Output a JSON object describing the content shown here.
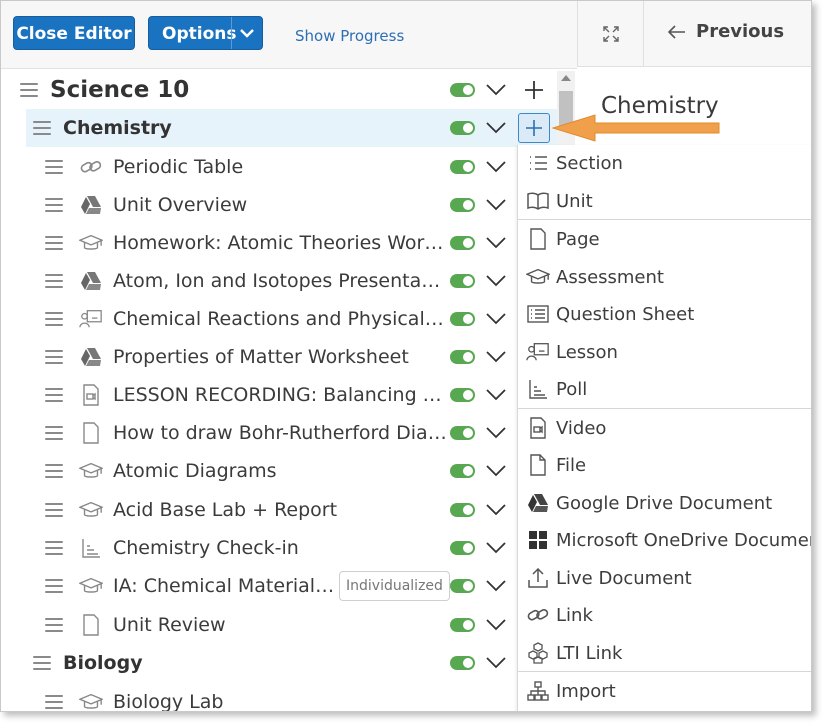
{
  "toolbar": {
    "close_label": "Close Editor",
    "options_label": "Options",
    "progress_label": "Show Progress",
    "previous_label": "Previous"
  },
  "right_panel": {
    "title": "Chemistry"
  },
  "tree": {
    "course": "Science 10",
    "units": [
      {
        "title": "Chemistry",
        "items": [
          {
            "label": "Periodic Table",
            "icon": "link-icon"
          },
          {
            "label": "Unit Overview",
            "icon": "google-drive-icon"
          },
          {
            "label": "Homework: Atomic Theories Worksheet",
            "icon": "assessment-icon"
          },
          {
            "label": "Atom, Ion and Isotopes Presentation",
            "icon": "google-drive-icon"
          },
          {
            "label": "Chemical Reactions and Physical Changes",
            "icon": "lesson-icon"
          },
          {
            "label": "Properties of Matter Worksheet",
            "icon": "google-drive-icon"
          },
          {
            "label": "LESSON RECORDING: Balancing Chemical Equations",
            "icon": "video-icon"
          },
          {
            "label": "How to draw Bohr-Rutherford Diagrams",
            "icon": "page-icon"
          },
          {
            "label": "Atomic Diagrams",
            "icon": "assessment-icon"
          },
          {
            "label": "Acid Base Lab + Report",
            "icon": "assessment-icon"
          },
          {
            "label": "Chemistry Check-in",
            "icon": "poll-icon"
          },
          {
            "label": "IA: Chemical Materials Project",
            "icon": "assessment-icon",
            "badge": "Individualized"
          },
          {
            "label": "Unit Review",
            "icon": "page-icon"
          }
        ]
      },
      {
        "title": "Biology",
        "items": [
          {
            "label": "Biology Lab",
            "icon": "assessment-icon"
          }
        ]
      }
    ]
  },
  "add_menu": {
    "items": [
      {
        "label": "Section",
        "icon": "list-icon"
      },
      {
        "label": "Unit",
        "icon": "book-icon"
      },
      {
        "label": "Page",
        "icon": "page-icon"
      },
      {
        "label": "Assessment",
        "icon": "assessment-icon"
      },
      {
        "label": "Question Sheet",
        "icon": "question-sheet-icon"
      },
      {
        "label": "Lesson",
        "icon": "lesson-icon"
      },
      {
        "label": "Poll",
        "icon": "poll-icon"
      },
      {
        "label": "Video",
        "icon": "video-icon"
      },
      {
        "label": "File",
        "icon": "file-icon"
      },
      {
        "label": "Google Drive Document",
        "icon": "google-drive-icon"
      },
      {
        "label": "Microsoft OneDrive Document",
        "icon": "windows-icon"
      },
      {
        "label": "Live Document",
        "icon": "upload-icon"
      },
      {
        "label": "Link",
        "icon": "link-icon"
      },
      {
        "label": "LTI Link",
        "icon": "cube-icon"
      },
      {
        "label": "Import",
        "icon": "sitemap-icon"
      }
    ]
  },
  "colors": {
    "primary": "#1a73c1",
    "toggle_on": "#58a852",
    "highlight": "#e7f3fb",
    "arrow": "#f0a04b"
  }
}
